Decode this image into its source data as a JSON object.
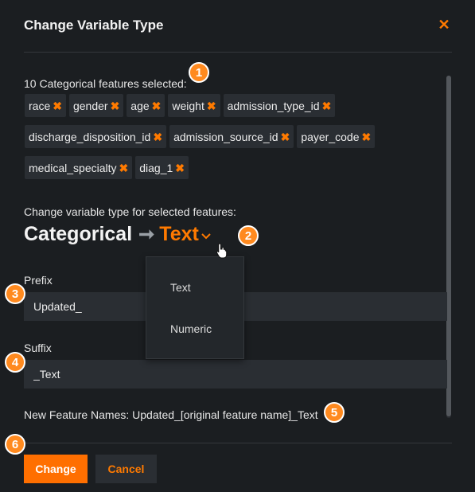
{
  "dialog": {
    "title": "Change Variable Type",
    "close_icon": "close-icon"
  },
  "features": {
    "selected_label": "10 Categorical features selected:",
    "chips": [
      [
        "race",
        "gender",
        "age",
        "weight",
        "admission_type_id"
      ],
      [
        "discharge_disposition_id",
        "admission_source_id",
        "payer_code"
      ],
      [
        "medical_specialty",
        "diag_1"
      ]
    ],
    "remove_symbol": "✖"
  },
  "change": {
    "label": "Change variable type for selected features:",
    "from_type": "Categorical",
    "arrow": "➞",
    "to_type": "Text"
  },
  "dropdown": {
    "options": [
      "Text",
      "Numeric"
    ]
  },
  "prefix": {
    "label": "Prefix",
    "value": "Updated_"
  },
  "suffix": {
    "label": "Suffix",
    "value": "_Text"
  },
  "new_names": {
    "text": "New Feature Names: Updated_[original feature name]_Text"
  },
  "buttons": {
    "change": "Change",
    "cancel": "Cancel"
  },
  "callouts": [
    "1",
    "2",
    "3",
    "4",
    "5",
    "6"
  ],
  "colors": {
    "accent": "#ff7a00",
    "background": "#1b1e21",
    "chip": "#2a2e33",
    "callout": "#ff8a1f"
  }
}
